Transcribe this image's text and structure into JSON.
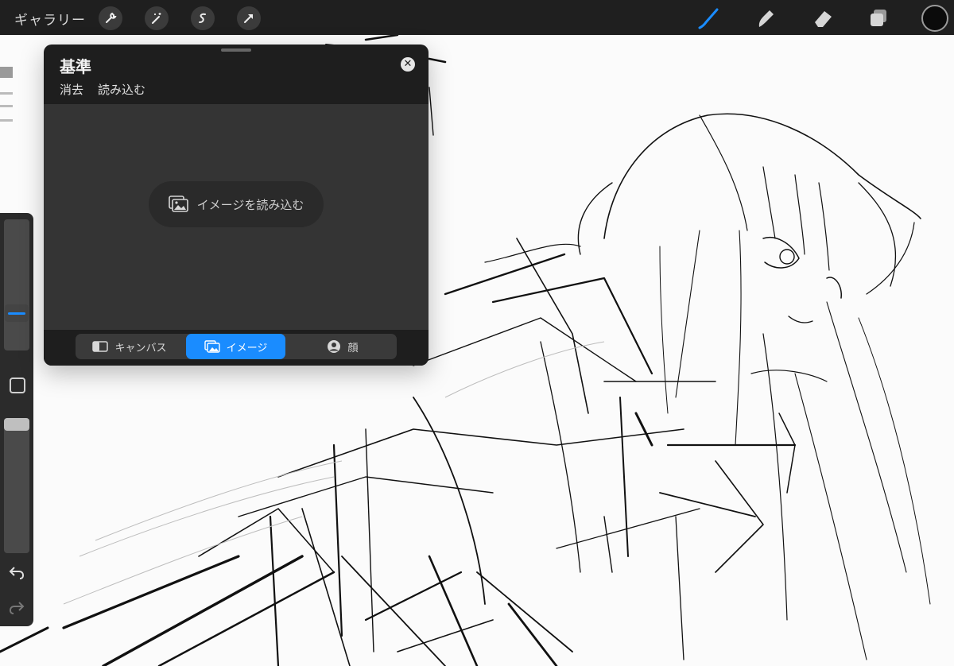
{
  "topbar": {
    "gallery_label": "ギャラリー",
    "left_tools": [
      "wrench-icon",
      "magic-wand-icon",
      "selection-icon",
      "arrow-icon"
    ],
    "right_tools": [
      "brush-icon",
      "smudge-icon",
      "eraser-icon",
      "layers-icon"
    ],
    "active_color": "#0b0b0b",
    "accent_color": "#1a8cff"
  },
  "reference_panel": {
    "title": "基準",
    "actions": {
      "clear": "消去",
      "import": "読み込む"
    },
    "import_image_label": "イメージを読み込む",
    "tabs": [
      {
        "label": "キャンバス",
        "icon": "canvas-icon",
        "selected": false
      },
      {
        "label": "イメージ",
        "icon": "image-icon",
        "selected": true
      },
      {
        "label": "顔",
        "icon": "face-icon",
        "selected": false
      }
    ]
  },
  "sidebar": {
    "brush_size_level": 0.25,
    "opacity_level": 1.0,
    "tools": [
      "modify-button",
      "undo-icon",
      "redo-icon"
    ]
  }
}
